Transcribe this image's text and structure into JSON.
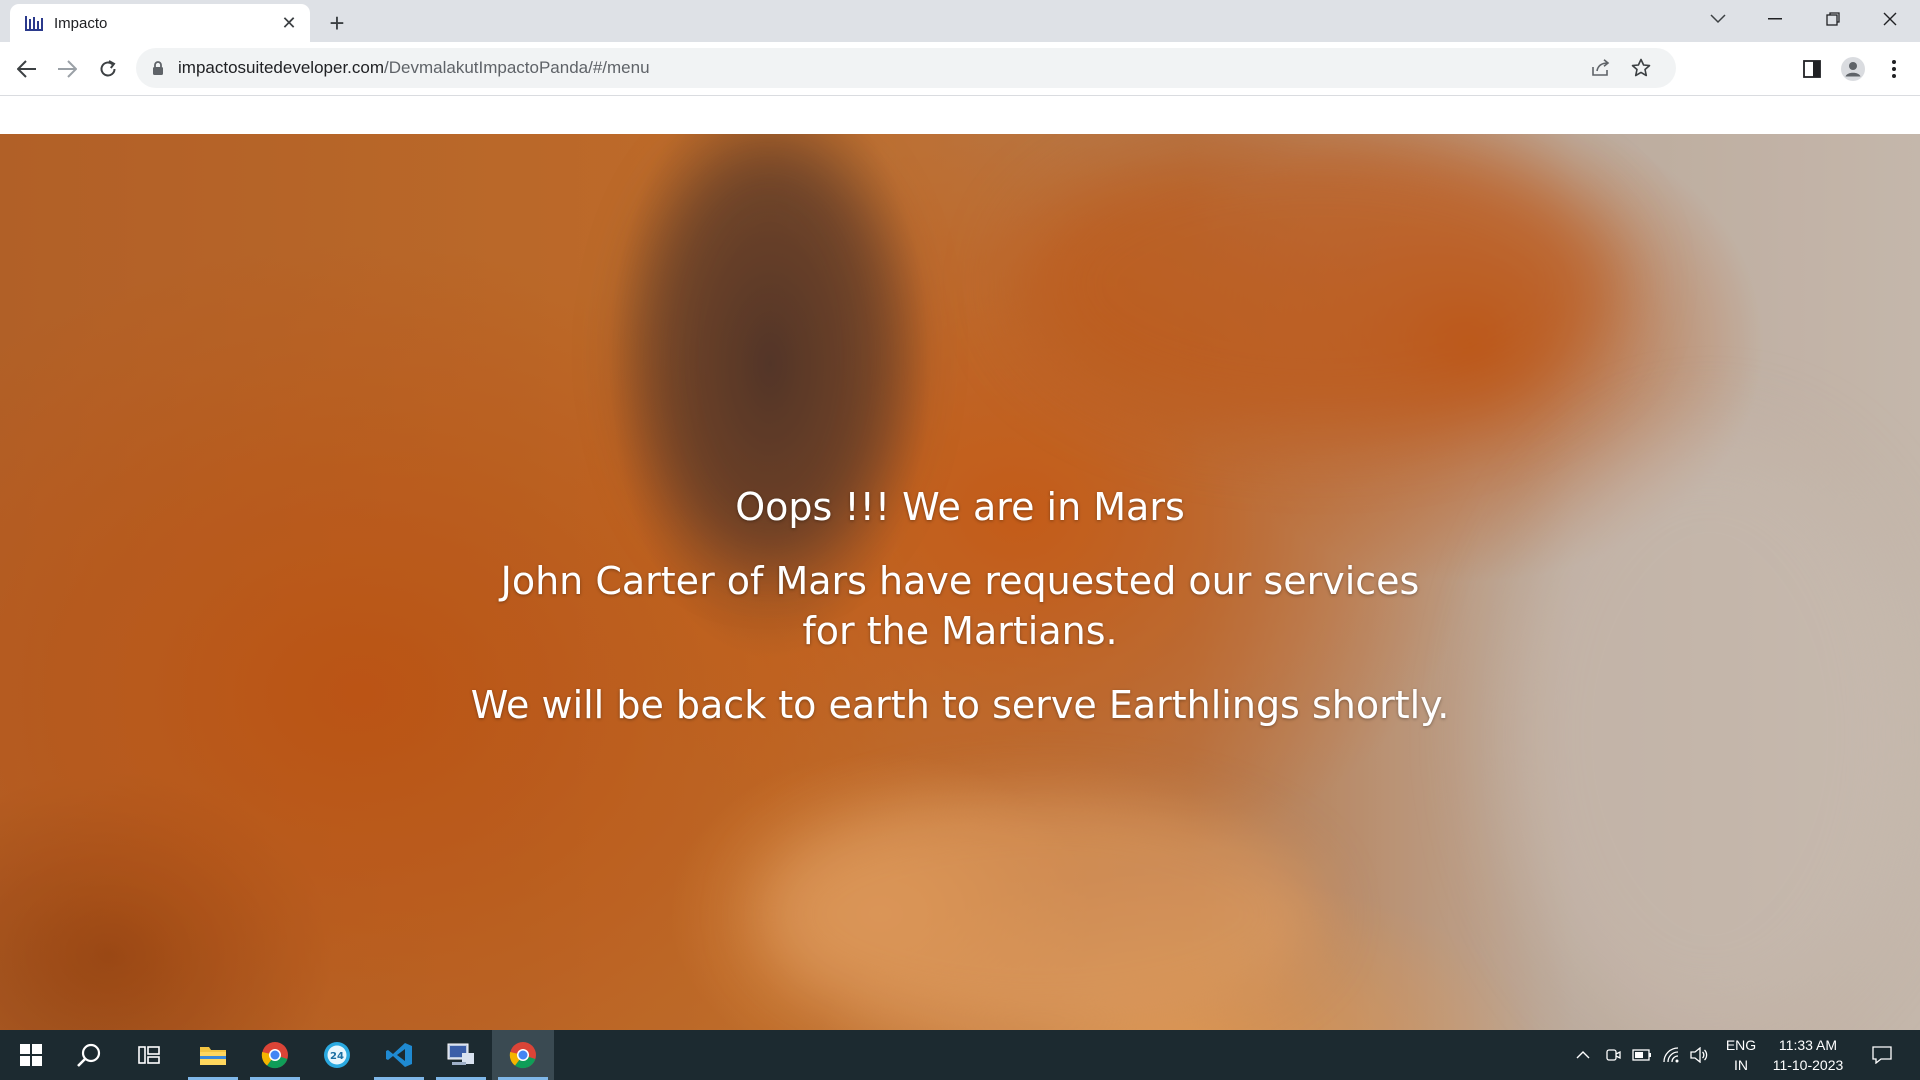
{
  "browser": {
    "tab_title": "Impacto",
    "new_tab_symbol": "+",
    "url_host": "impactosuitedeveloper.com",
    "url_path": "/DevmalakutImpactoPanda/#/menu"
  },
  "page": {
    "line1": "Oops !!! We are in Mars",
    "line2": "John Carter of Mars have requested our services for the Martians.",
    "line3": "We will be back to earth to serve Earthlings shortly."
  },
  "taskbar": {
    "apps": [
      "windows-start",
      "search",
      "task-view",
      "file-explorer",
      "chrome",
      "app-24",
      "vs-code",
      "network-app",
      "chrome-active"
    ],
    "app_24_label": "24",
    "lang_top": "ENG",
    "lang_bottom": "IN",
    "time": "11:33 AM",
    "date": "11-10-2023"
  },
  "colors": {
    "tabstrip": "#dee1e6",
    "taskbar": "#1c2a30",
    "message_text": "#ffffff"
  }
}
